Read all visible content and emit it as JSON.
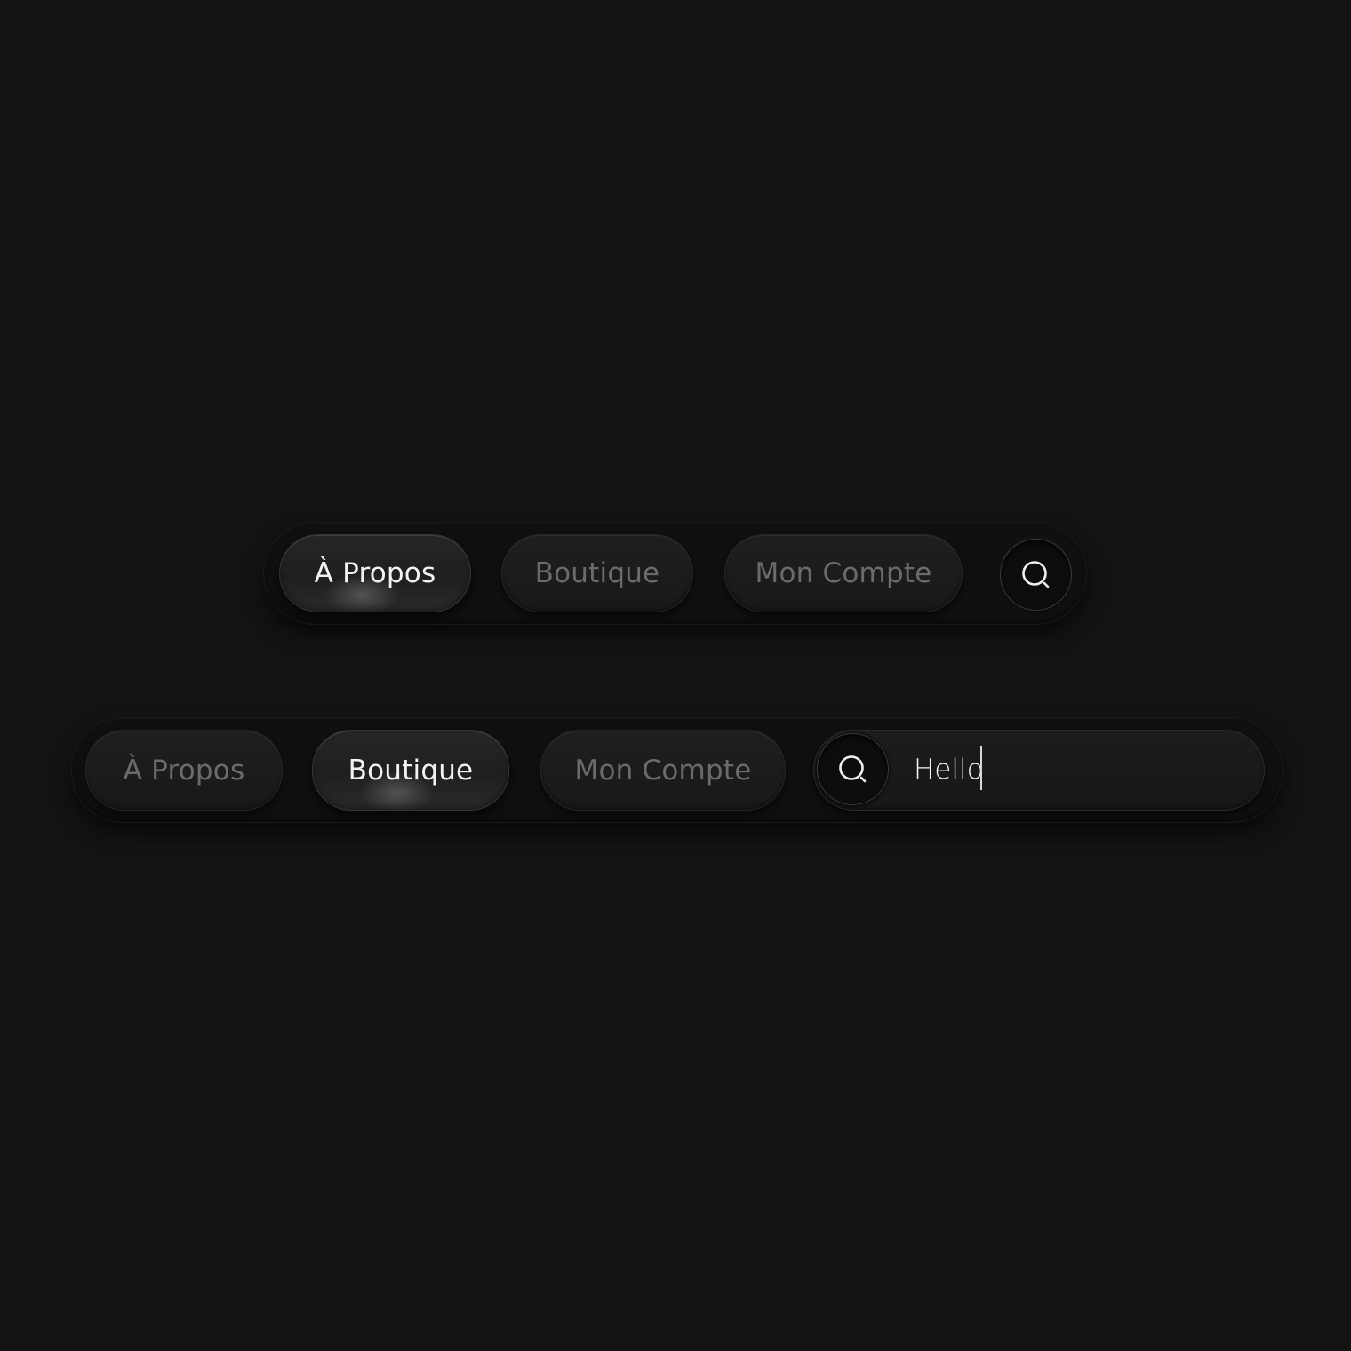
{
  "nav_top": {
    "items": [
      {
        "label": "À Propos",
        "active": true
      },
      {
        "label": "Boutique",
        "active": false
      },
      {
        "label": "Mon Compte",
        "active": false
      }
    ],
    "search_icon": "search-icon"
  },
  "nav_bottom": {
    "items": [
      {
        "label": "À Propos",
        "active": false
      },
      {
        "label": "Boutique",
        "active": true
      },
      {
        "label": "Mon Compte",
        "active": false
      }
    ],
    "search_icon": "search-icon",
    "search_value": "Hello"
  },
  "colors": {
    "background": "#131313",
    "active_text": "#f2f2f2",
    "inactive_text": "#6b6b6b"
  }
}
